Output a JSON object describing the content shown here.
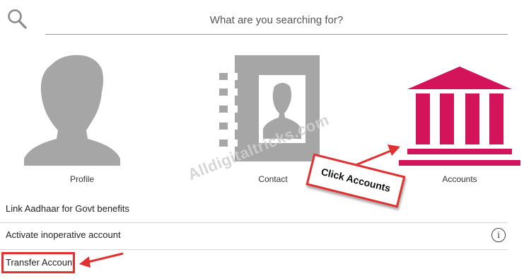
{
  "search": {
    "placeholder": "What are you searching for?"
  },
  "tiles": [
    {
      "label": "Profile",
      "icon": "profile-silhouette-icon"
    },
    {
      "label": "Contact",
      "icon": "contact-book-icon"
    },
    {
      "label": "Accounts",
      "icon": "bank-building-icon"
    }
  ],
  "menu": [
    {
      "label": "Link Aadhaar for Govt benefits"
    },
    {
      "label": "Activate inoperative account",
      "has_info": true
    },
    {
      "label": "Transfer Account"
    }
  ],
  "annotation": {
    "callout": "Click Accounts"
  },
  "watermark": "Alldigitaltricks.com",
  "colors": {
    "accent": "#d4145a",
    "grey_icon": "#a6a6a6",
    "annotation_red": "#e03030"
  }
}
